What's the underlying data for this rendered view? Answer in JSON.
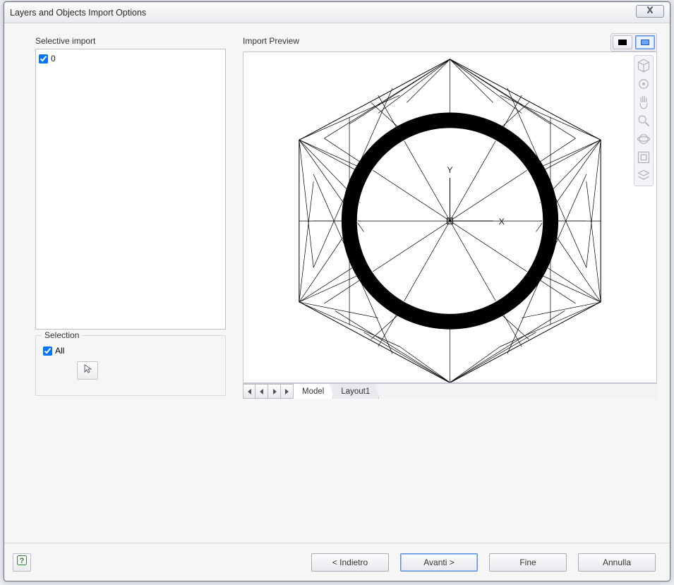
{
  "window": {
    "title": "Layers and Objects Import Options"
  },
  "left": {
    "selective_import_label": "Selective import",
    "tree": {
      "items": [
        {
          "label": "0",
          "checked": true
        }
      ]
    },
    "selection": {
      "legend": "Selection",
      "all_label": "All",
      "all_checked": true
    }
  },
  "preview": {
    "label": "Import Preview",
    "axes": {
      "x": "X",
      "y": "Y"
    },
    "tabs": {
      "model": "Model",
      "layout1": "Layout1"
    }
  },
  "footer": {
    "back": "< Indietro",
    "next": "Avanti >",
    "finish": "Fine",
    "cancel": "Annulla"
  }
}
